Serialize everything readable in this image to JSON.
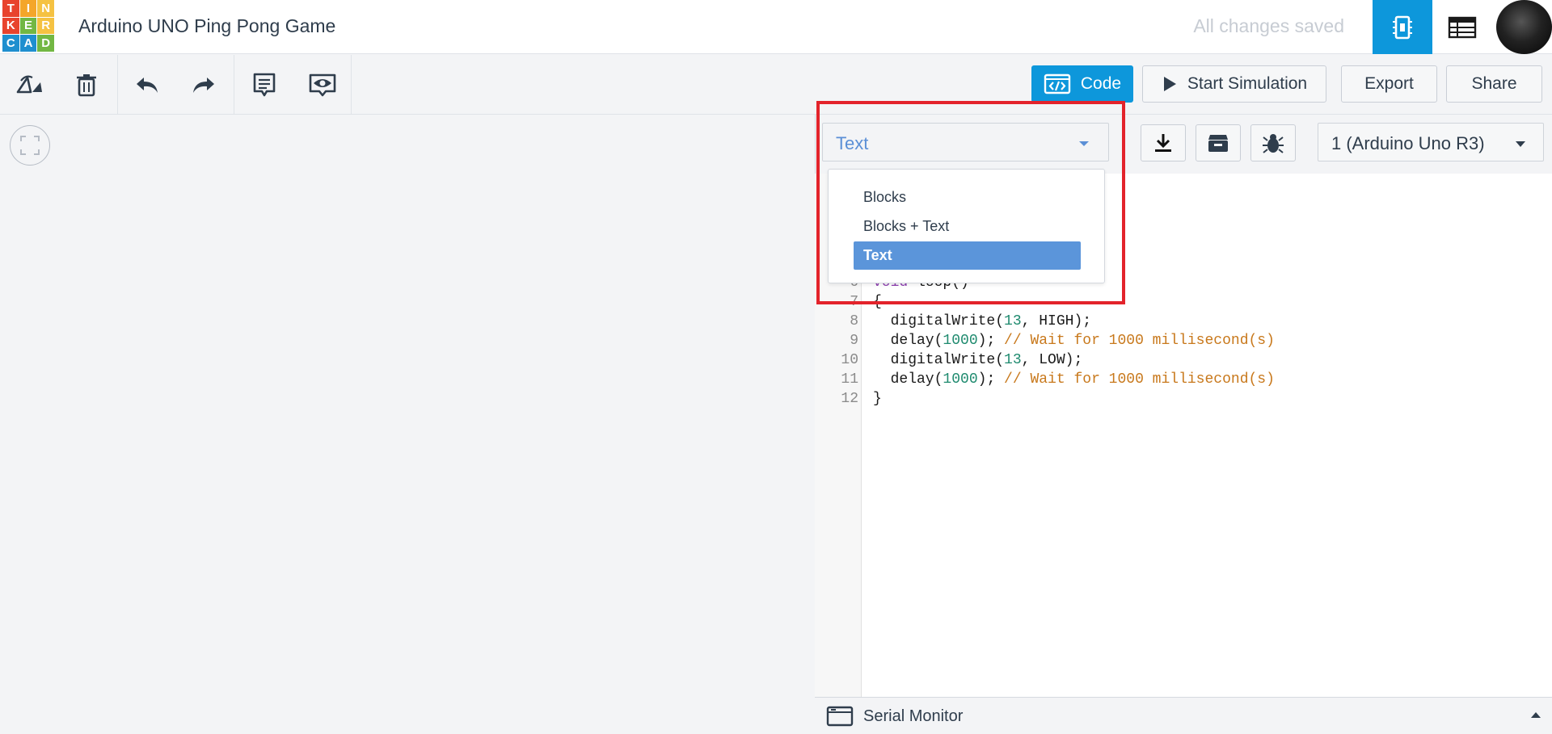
{
  "app": {
    "logo_letters": [
      "T",
      "I",
      "N",
      "K",
      "E",
      "R",
      "C",
      "A",
      "D"
    ],
    "logo_colors": [
      "#e8432d",
      "#f4a62a",
      "#f5c242",
      "#e8432d",
      "#72b743",
      "#f5c242",
      "#1f8fcf",
      "#1f8fcf",
      "#72b743"
    ]
  },
  "header": {
    "title": "Arduino UNO Ping Pong Game",
    "save_status": "All changes saved"
  },
  "toolbar": {
    "code_label": "Code",
    "start_simulation_label": "Start Simulation",
    "export_label": "Export",
    "share_label": "Share"
  },
  "editor": {
    "mode_selected": "Text",
    "mode_options": [
      "Blocks",
      "Blocks + Text",
      "Text"
    ],
    "board_selected": "1 (Arduino Uno R3)",
    "line_numbers": [
      "6",
      "7",
      "8",
      "9",
      "10",
      "11",
      "12"
    ],
    "lines": {
      "l6_kw": "void",
      "l6_rest": " loop()",
      "l7": "{",
      "l8_a": "  digitalWrite(",
      "l8_num": "13",
      "l8_b": ", HIGH);",
      "l9_a": "  delay(",
      "l9_num": "1000",
      "l9_b": "); ",
      "l9_cmt": "// Wait for 1000 millisecond(s)",
      "l10_a": "  digitalWrite(",
      "l10_num": "13",
      "l10_b": ", LOW);",
      "l11_a": "  delay(",
      "l11_num": "1000",
      "l11_b": "); ",
      "l11_cmt": "// Wait for 1000 millisecond(s)",
      "l12": "}"
    }
  },
  "serial_monitor": {
    "label": "Serial Monitor"
  },
  "colors": {
    "accent": "#0d97db",
    "highlight": "#e3232b",
    "selected_option": "#5b95da"
  }
}
